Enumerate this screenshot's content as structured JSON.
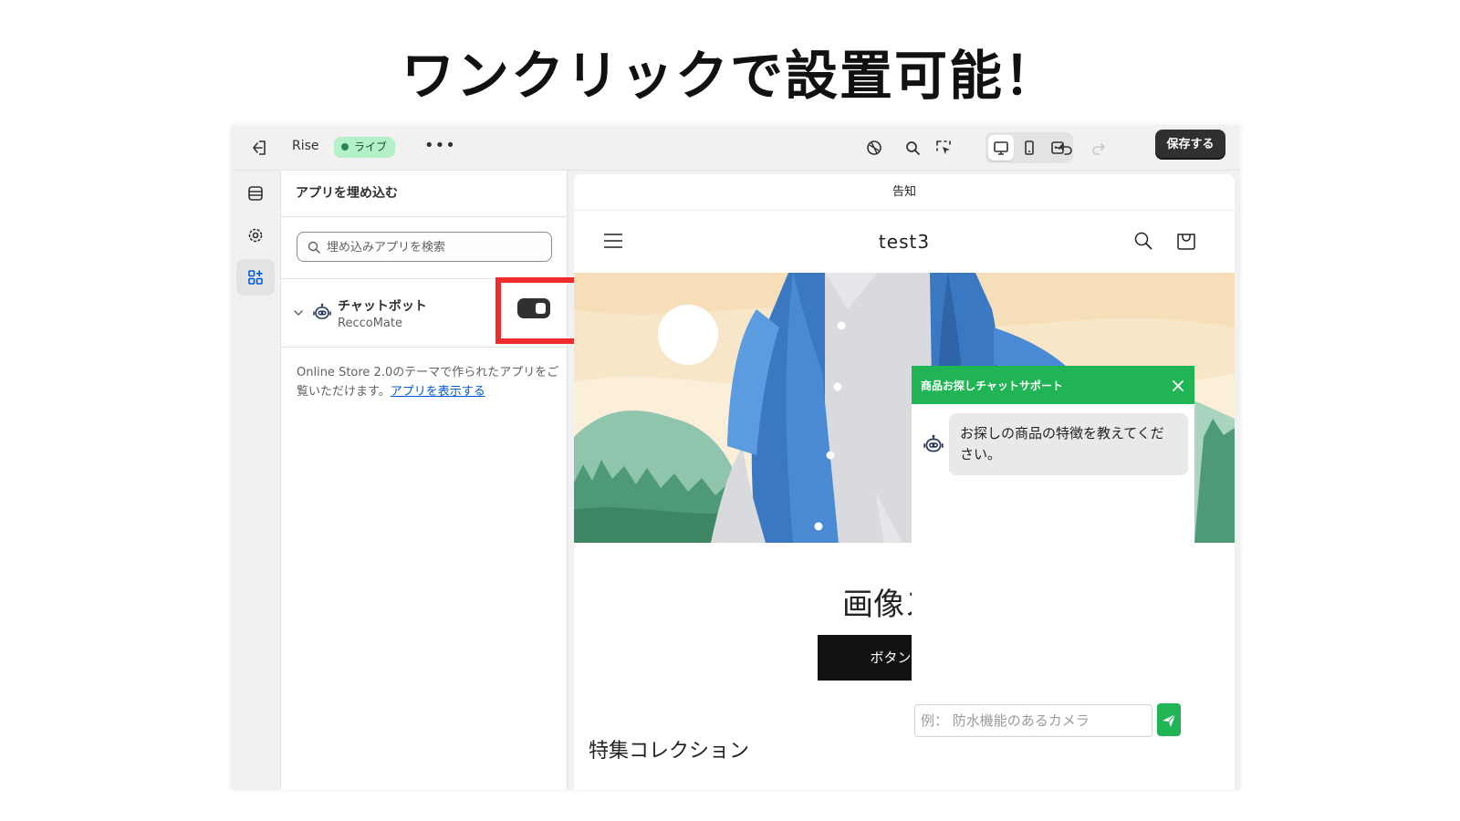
{
  "headline": "ワンクリックで設置可能！",
  "topbar": {
    "theme_name": "Rise",
    "status_badge": "ライブ",
    "more_label": "•••",
    "save_label": "保存する"
  },
  "panel": {
    "title": "アプリを埋め込む",
    "search_placeholder": "埋め込みアプリを検索",
    "app": {
      "name": "チャットボット",
      "developer": "ReccoMate",
      "enabled": true
    },
    "note_text": "Online Store 2.0のテーマで作られたアプリをご覧いただけます。",
    "note_link": "アプリを表示する"
  },
  "preview": {
    "announcement": "告知",
    "store_name": "test3",
    "slideshow_title": "画像スラ",
    "slideshow_button": "ボタンのテ",
    "collection_title": "特集コレクション"
  },
  "chat": {
    "title": "商品お探しチャットサポート",
    "bot_message": "お探しの商品の特徴を教えてください。",
    "input_placeholder": "例： 防水機能のあるカメラ"
  },
  "colors": {
    "accent_green": "#20b454",
    "highlight_red": "#ef2b2b",
    "live_badge": "#b4f0c8"
  }
}
